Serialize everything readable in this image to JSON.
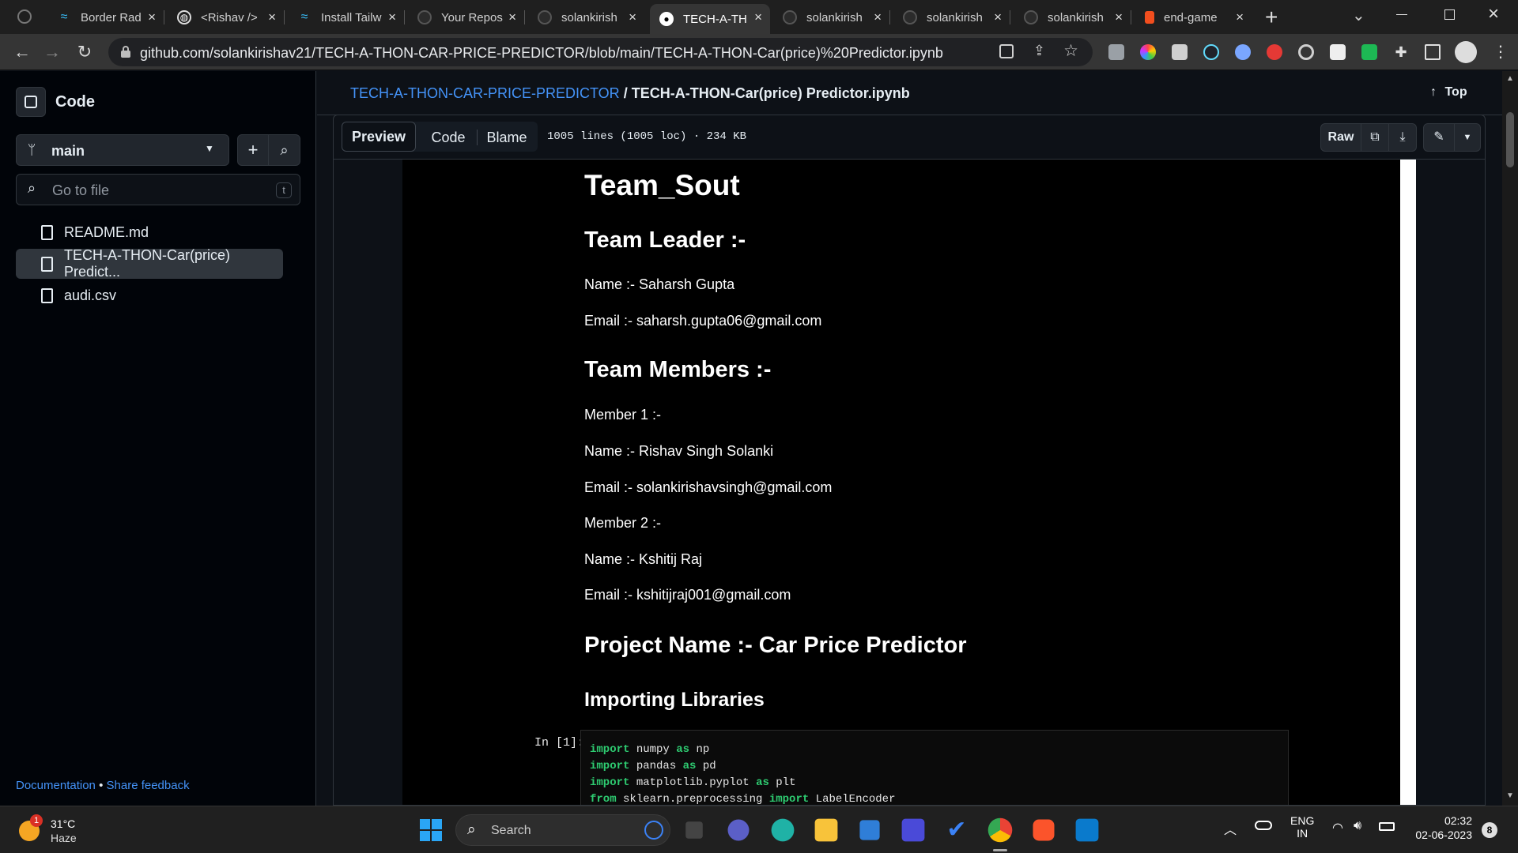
{
  "tabs": [
    {
      "label": "Border Rad",
      "icon": "tailwind-icon"
    },
    {
      "label": "<Rishav />",
      "icon": "globe-icon"
    },
    {
      "label": "Install Tailw",
      "icon": "tailwind-icon"
    },
    {
      "label": "Your Repos",
      "icon": "github-icon"
    },
    {
      "label": "solankirish",
      "icon": "github-icon"
    },
    {
      "label": "TECH-A-TH",
      "icon": "github-icon"
    },
    {
      "label": "solankirish",
      "icon": "github-icon"
    },
    {
      "label": "solankirish",
      "icon": "github-icon"
    },
    {
      "label": "solankirish",
      "icon": "github-icon"
    },
    {
      "label": "end-game",
      "icon": "figma-icon"
    }
  ],
  "browser": {
    "url": "github.com/solankirishav21/TECH-A-THON-CAR-PRICE-PREDICTOR/blob/main/TECH-A-THON-Car(price)%20Predictor.ipynb"
  },
  "sidebar": {
    "title": "Code",
    "branch": "main",
    "go_to_file_placeholder": "Go to file",
    "shortcut_key": "t",
    "files": [
      {
        "name": "README.md"
      },
      {
        "name": "TECH-A-THON-Car(price) Predict..."
      },
      {
        "name": "audi.csv"
      }
    ],
    "footer_doc": "Documentation",
    "footer_sep": "•",
    "footer_feedback": "Share feedback"
  },
  "header": {
    "repo": "TECH-A-THON-CAR-PRICE-PREDICTOR",
    "separator": "/",
    "file": "TECH-A-THON-Car(price) Predictor.ipynb",
    "top_label": "Top"
  },
  "filebar": {
    "tabs": [
      "Preview",
      "Code",
      "Blame"
    ],
    "meta": "1005 lines (1005 loc) · 234 KB",
    "raw_label": "Raw"
  },
  "notebook": {
    "team_name": "Team_Sout",
    "leader_heading": "Team Leader :-",
    "leader_name": "Name :- Saharsh Gupta",
    "leader_email": "Email :- saharsh.gupta06@gmail.com",
    "members_heading": "Team Members :-",
    "member1": "Member 1 :-",
    "member1_name": "Name :- Rishav Singh Solanki",
    "member1_email": "Email :- solankirishavsingh@gmail.com",
    "member2": "Member 2 :-",
    "member2_name": "Name :- Kshitij Raj",
    "member2_email": "Email :- kshitijraj001@gmail.com",
    "project_heading": "Project Name :- Car Price Predictor",
    "libs_heading": "Importing Libraries",
    "prompt": "In [1]:",
    "code": [
      {
        "kw1": "import",
        "mod": " numpy ",
        "kw2": "as",
        "alias": " np"
      },
      {
        "kw1": "import",
        "mod": " pandas ",
        "kw2": "as",
        "alias": " pd"
      },
      {
        "kw1": "import",
        "mod": " matplotlib.pyplot ",
        "kw2": "as",
        "alias": " plt"
      },
      {
        "kw1": "from",
        "mod": " sklearn.preprocessing ",
        "kw2": "import",
        "alias": " LabelEncoder"
      }
    ]
  },
  "taskbar": {
    "weather_temp": "31°C",
    "weather_desc": "Haze",
    "weather_badge": "1",
    "search_label": "Search",
    "lang_top": "ENG",
    "lang_bottom": "IN",
    "time": "02:32",
    "date": "02-06-2023",
    "notif_count": "8"
  },
  "colors": {
    "accent_link": "#4493f8",
    "code_keyword": "#2ecc71"
  }
}
